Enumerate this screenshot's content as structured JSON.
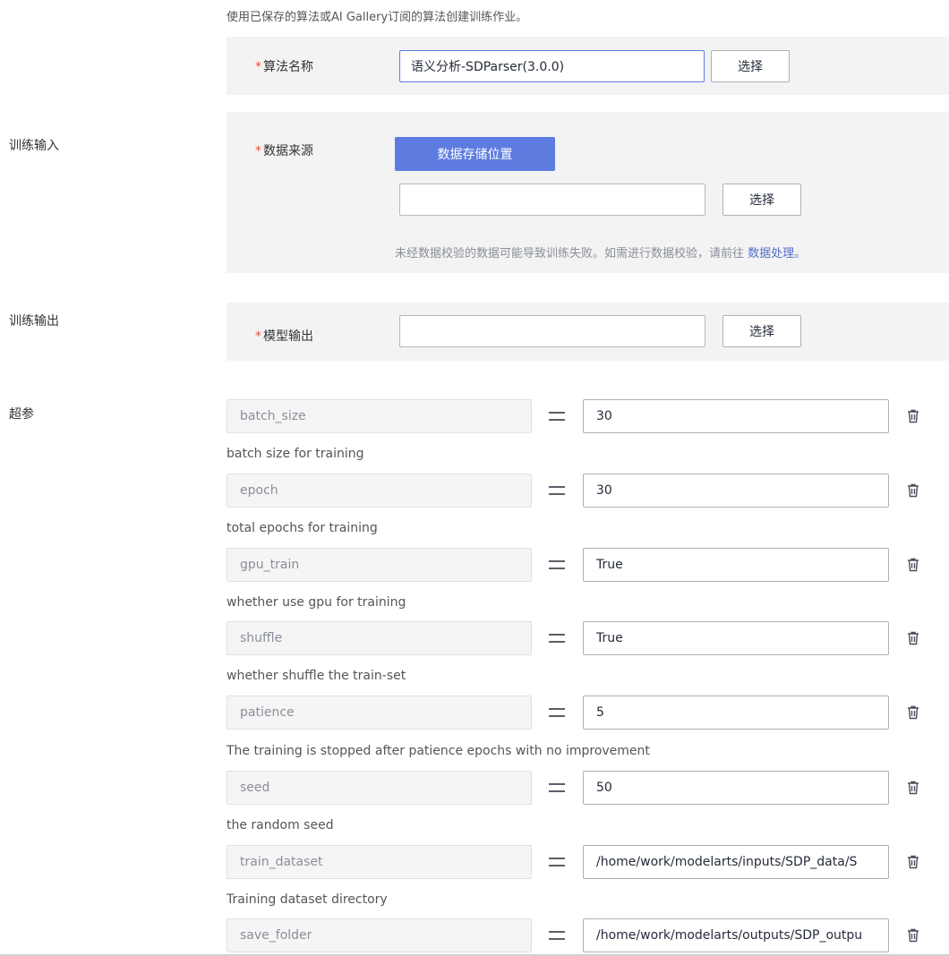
{
  "intro_text": "使用已保存的算法或AI Gallery订阅的算法创建训练作业。",
  "algorithm": {
    "required_mark": "*",
    "label": "算法名称",
    "value": "语义分析-SDParser(3.0.0)",
    "select_label": "选择"
  },
  "training_input": {
    "section_label": "训练输入",
    "required_mark": "*",
    "label": "数据来源",
    "storage_button": "数据存储位置",
    "path_value": "",
    "select_label": "选择",
    "hint_prefix": "未经数据校验的数据可能导致训练失败。如需进行数据校验，请前往",
    "hint_link": "数据处理。"
  },
  "training_output": {
    "section_label": "训练输出",
    "required_mark": "*",
    "label": "模型输出",
    "path_value": "",
    "select_label": "选择"
  },
  "hyperparams": {
    "section_label": "超参",
    "equals_icon": "equals-icon",
    "delete_icon": "trash-icon",
    "items": [
      {
        "key": "batch_size",
        "value": "30",
        "desc": "batch size for training"
      },
      {
        "key": "epoch",
        "value": "30",
        "desc": "total epochs for training"
      },
      {
        "key": "gpu_train",
        "value": "True",
        "desc": "whether use gpu for training"
      },
      {
        "key": "shuffle",
        "value": "True",
        "desc": "whether shuffle the train-set"
      },
      {
        "key": "patience",
        "value": "5",
        "desc": "The training is stopped after patience epochs with no improvement"
      },
      {
        "key": "seed",
        "value": "50",
        "desc": "the random seed"
      },
      {
        "key": "train_dataset",
        "value": "/home/work/modelarts/inputs/SDP_data/S",
        "desc": "Training dataset directory"
      },
      {
        "key": "save_folder",
        "value": "/home/work/modelarts/outputs/SDP_outpu",
        "desc": ""
      }
    ]
  },
  "colors": {
    "primary": "#5e7ce0",
    "required": "#e84e40",
    "link": "#526ecc",
    "panel_bg": "#f3f3f3"
  }
}
